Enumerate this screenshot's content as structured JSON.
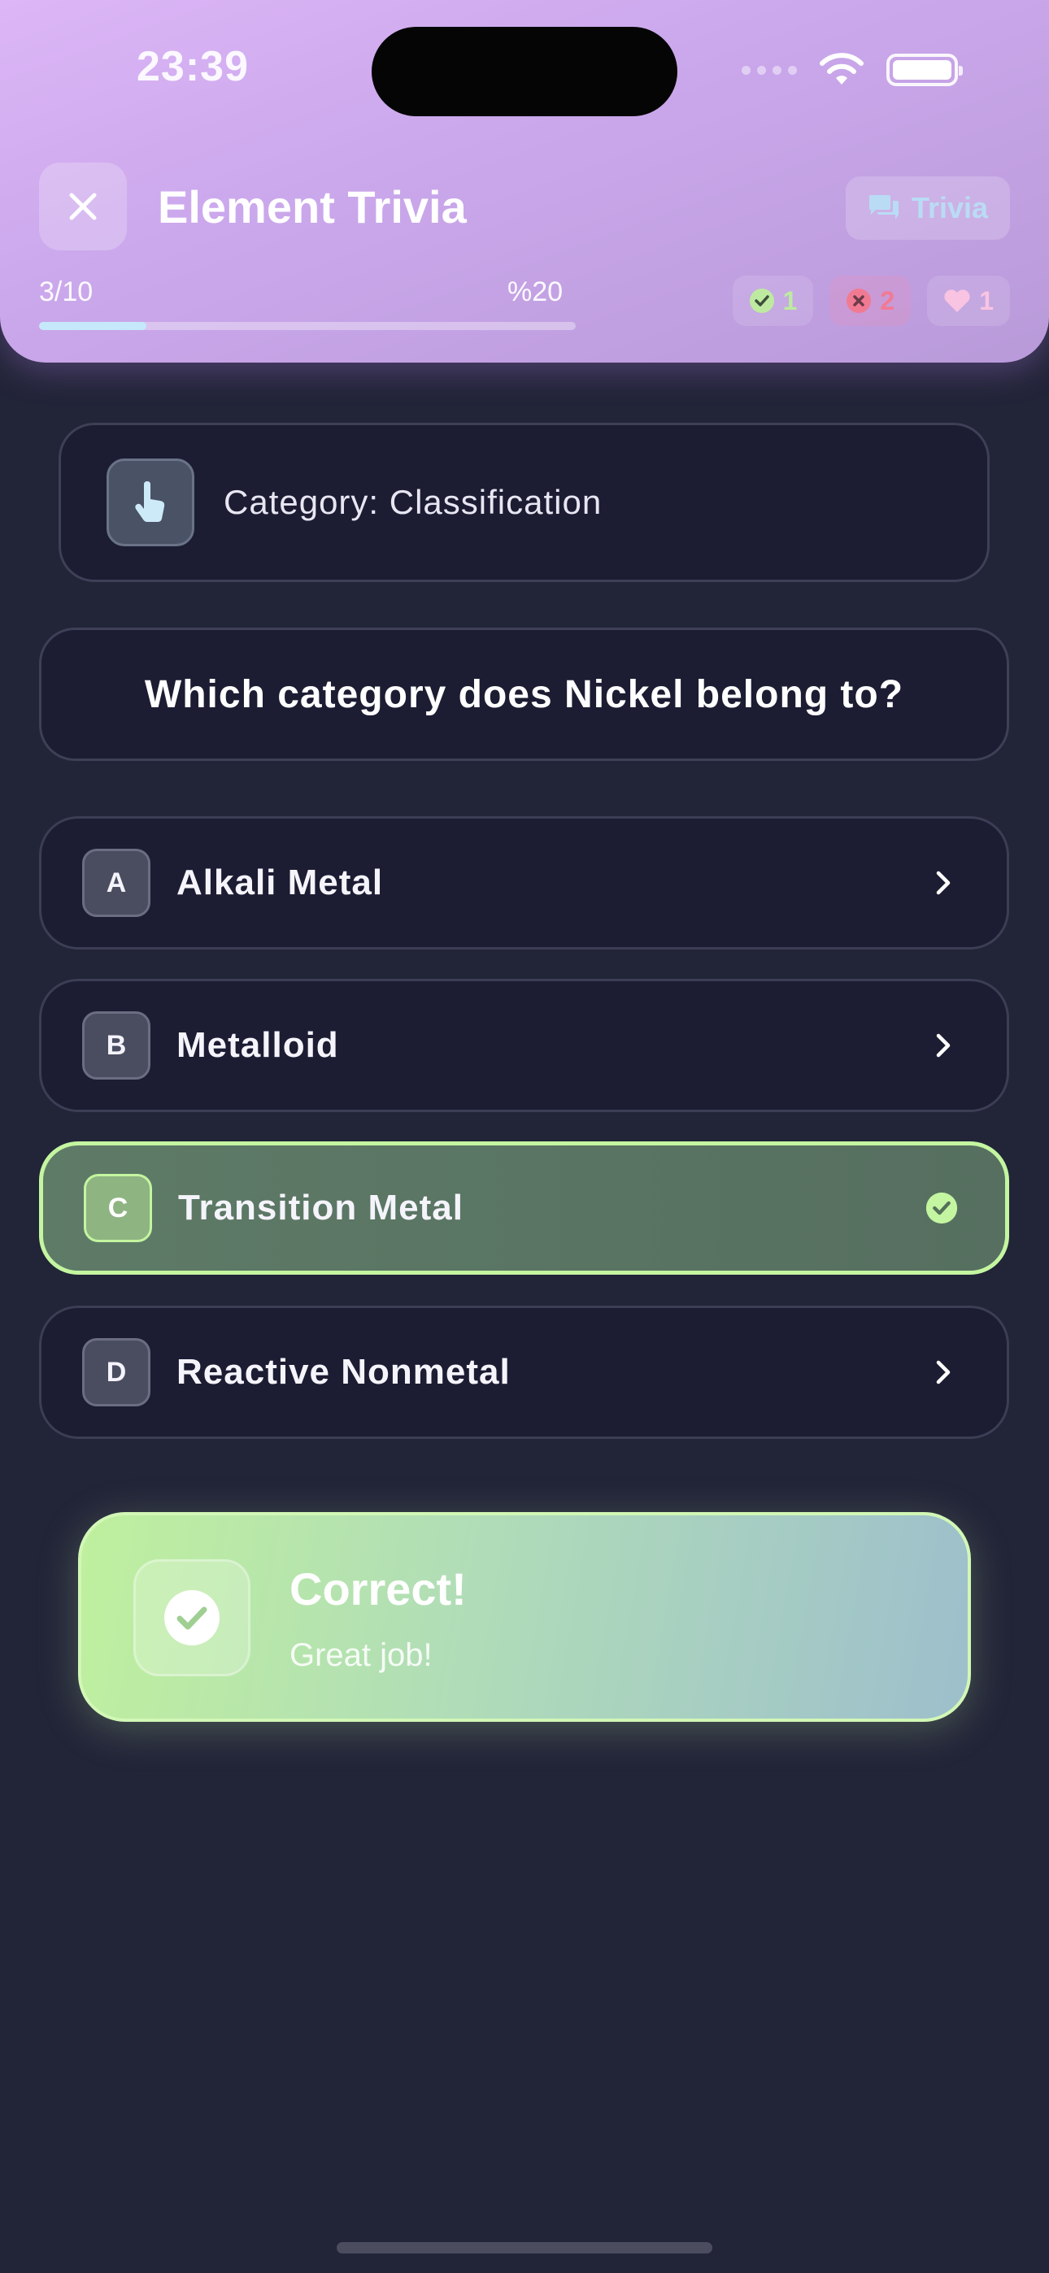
{
  "status_bar": {
    "time": "23:39"
  },
  "header": {
    "title": "Element Trivia",
    "mode_chip": "Trivia",
    "progress": {
      "count": "3/10",
      "percent_label": "%20",
      "fraction": 0.2
    },
    "stats": {
      "correct": "1",
      "wrong": "2",
      "lives": "1"
    },
    "colors": {
      "accent_correct": "#bdeaa0",
      "accent_wrong": "#f17a93",
      "accent_lives": "#f8c4e2"
    }
  },
  "category": {
    "label": "Category: Classification",
    "icon": "hand-pointer-icon"
  },
  "question": {
    "text": "Which category does Nickel belong to?"
  },
  "answers": [
    {
      "letter": "A",
      "label": "Alkali Metal",
      "state": "default"
    },
    {
      "letter": "B",
      "label": "Metalloid",
      "state": "default"
    },
    {
      "letter": "C",
      "label": "Transition Metal",
      "state": "correct"
    },
    {
      "letter": "D",
      "label": "Reactive Nonmetal",
      "state": "default"
    }
  ],
  "feedback": {
    "title": "Correct!",
    "subtitle": "Great job!",
    "color": "#bff09e"
  }
}
